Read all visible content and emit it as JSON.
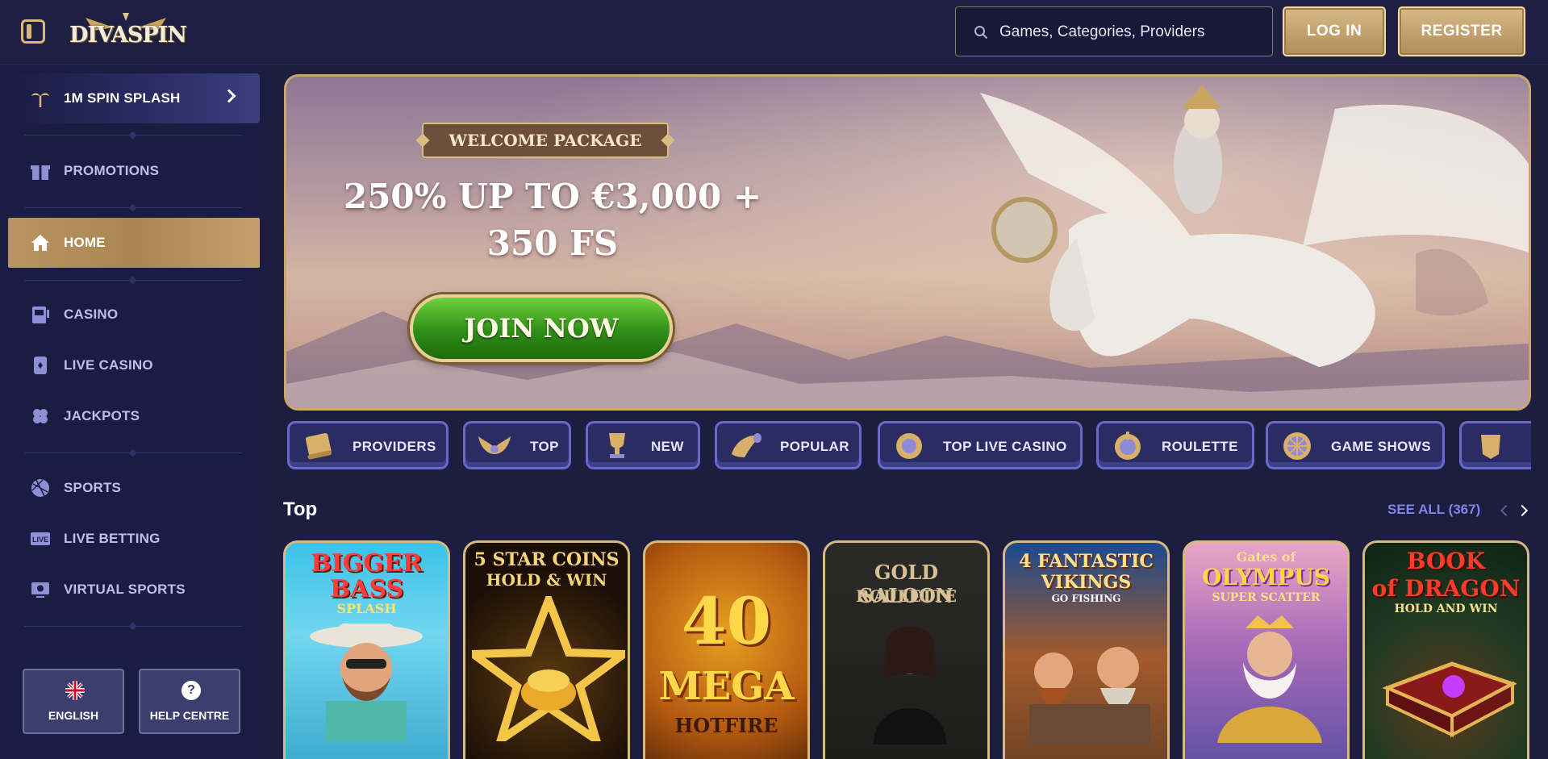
{
  "header": {
    "logo_text": "DIVASPIN",
    "search_placeholder": "Games, Categories, Providers",
    "login_label": "LOG IN",
    "register_label": "REGISTER"
  },
  "sidebar": {
    "promo_banner": "1M SPIN SPLASH",
    "items": [
      {
        "label": "PROMOTIONS",
        "icon": "gift-icon"
      },
      {
        "label": "HOME",
        "icon": "home-icon",
        "active": true
      },
      {
        "label": "CASINO",
        "icon": "slot-machine-icon"
      },
      {
        "label": "LIVE CASINO",
        "icon": "playing-card-icon"
      },
      {
        "label": "JACKPOTS",
        "icon": "clover-icon"
      },
      {
        "label": "SPORTS",
        "icon": "ball-icon"
      },
      {
        "label": "LIVE BETTING",
        "icon": "live-icon"
      },
      {
        "label": "VIRTUAL SPORTS",
        "icon": "monitor-ball-icon"
      }
    ],
    "language_label": "ENGLISH",
    "help_label": "HELP CENTRE"
  },
  "banner": {
    "badge": "WELCOME PACKAGE",
    "offer_line1": "250% UP TO €3,000 +",
    "offer_line2": "350 FS",
    "cta": "JOIN NOW"
  },
  "categories": [
    {
      "label": "PROVIDERS",
      "icon": "scroll-icon"
    },
    {
      "label": "TOP",
      "icon": "wings-icon"
    },
    {
      "label": "NEW",
      "icon": "trophy-icon"
    },
    {
      "label": "POPULAR",
      "icon": "horn-icon"
    },
    {
      "label": "TOP LIVE CASINO",
      "icon": "chip-icon"
    },
    {
      "label": "ROULETTE",
      "icon": "roulette-icon"
    },
    {
      "label": "GAME SHOWS",
      "icon": "wheel-icon"
    }
  ],
  "top_section": {
    "title": "Top",
    "see_all": "SEE ALL (367)",
    "games": [
      {
        "title_line1": "BIGGER",
        "title_line2": "BASS",
        "title_line3": "SPLASH"
      },
      {
        "title_line1": "5 STAR COINS",
        "title_line2": "HOLD & WIN"
      },
      {
        "title_line1": "40",
        "title_line2": "MEGA",
        "title_line3": "HOTFIRE"
      },
      {
        "title_line1": "GOLD SALOON",
        "title_line2": "ROULETTE"
      },
      {
        "title_line1": "4 FANTASTIC",
        "title_line2": "VIKINGS",
        "title_line3": "GO FISHING"
      },
      {
        "title_line1": "Gates of",
        "title_line2": "OLYMPUS",
        "title_line3": "SUPER SCATTER"
      },
      {
        "title_line1": "BOOK",
        "title_line2": "of DRAGON",
        "title_line3": "HOLD AND WIN"
      }
    ]
  },
  "colors": {
    "background": "#1c1d3f",
    "gold": "#d8b985",
    "accent_link": "#7e85e8"
  }
}
